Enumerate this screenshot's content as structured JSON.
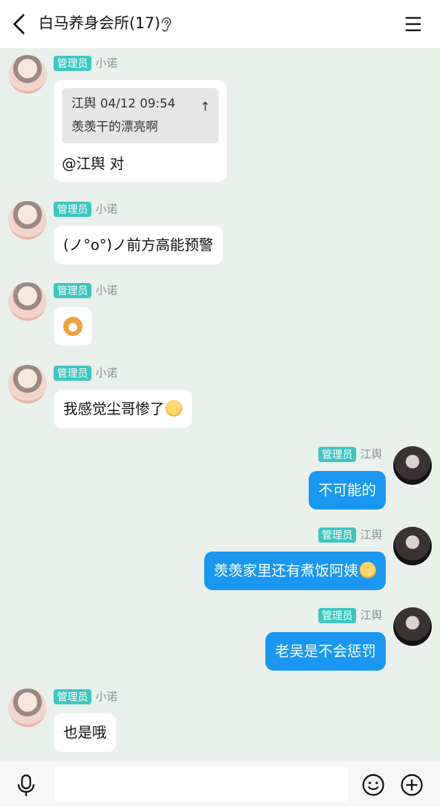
{
  "header": {
    "title": "白马养身会所(17)"
  },
  "messages": [
    {
      "side": "left",
      "badge": "管理员",
      "nick": "小诺",
      "quote": {
        "author_time": "江舆 04/12 09:54",
        "text": "羡羡干的漂亮啊",
        "arrow": "↑"
      },
      "text": "@江舆 对"
    },
    {
      "side": "left",
      "badge": "管理员",
      "nick": "小诺",
      "text": "(ノ°o°)ノ前方高能预警"
    },
    {
      "side": "left",
      "badge": "管理员",
      "nick": "小诺",
      "sticker": "shiba-dog-sticker"
    },
    {
      "side": "left",
      "badge": "管理员",
      "nick": "小诺",
      "text": "我感觉尘哥惨了",
      "emoji": "shy-smile-emoji"
    },
    {
      "side": "right",
      "badge": "管理员",
      "nick": "江舆",
      "text": "不可能的"
    },
    {
      "side": "right",
      "badge": "管理员",
      "nick": "江舆",
      "text": "羡羡家里还有煮饭阿姨",
      "emoji": "yum-emoji"
    },
    {
      "side": "right",
      "badge": "管理员",
      "nick": "江舆",
      "text": "老吴是不会惩罚"
    },
    {
      "side": "left",
      "badge": "管理员",
      "nick": "小诺",
      "text": "也是哦"
    }
  ],
  "input": {
    "value": "",
    "placeholder": ""
  },
  "colors": {
    "background": "#eaf0ec",
    "badge": "#3cc7c2",
    "outgoing_bubble": "#1a97f0",
    "incoming_bubble": "#ffffff"
  }
}
